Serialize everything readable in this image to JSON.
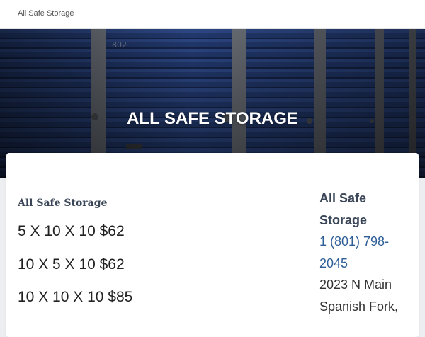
{
  "header": {
    "site_name": "All Safe Storage"
  },
  "hero": {
    "title": "ALL SAFE STORAGE",
    "door_number": "802"
  },
  "main": {
    "section_title": "All Safe Storage",
    "units": [
      "5 X 10 X 10 $62",
      "10 X 5 X 10 $62",
      "10 X 10 X 10 $85"
    ]
  },
  "contact": {
    "business_name": "All Safe Storage",
    "phone": "1 (801) 798-2045",
    "address_line1": "2023 N Main",
    "address_line2": "Spanish Fork,"
  },
  "colors": {
    "accent": "#2e5e96",
    "door_blue": "#2f4f9a",
    "heading": "#3a4657"
  }
}
